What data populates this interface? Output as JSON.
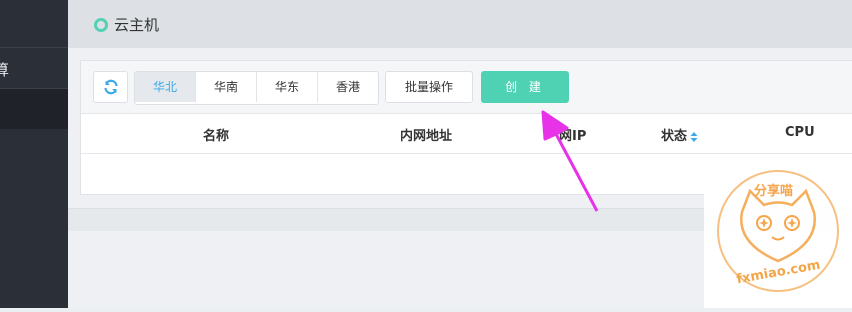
{
  "sidebar": {
    "items": [
      {
        "label": "算",
        "active": false
      },
      {
        "label": "",
        "active": true
      }
    ]
  },
  "header": {
    "title": "云主机",
    "status_color": "#55d0b5"
  },
  "toolbar": {
    "refresh_icon": "refresh-icon",
    "regions": [
      {
        "label": "华北",
        "active": true
      },
      {
        "label": "华南",
        "active": false
      },
      {
        "label": "华东",
        "active": false
      },
      {
        "label": "香港",
        "active": false
      }
    ],
    "batch_label": "批量操作",
    "create_label": "创 建",
    "accent_color": "#4fd1b3",
    "active_tab_color": "#3ba8e8"
  },
  "table": {
    "columns": [
      {
        "label": "名称"
      },
      {
        "label": "内网地址"
      },
      {
        "label": "网IP"
      },
      {
        "label": "状态",
        "sortable": true
      },
      {
        "label": "CPU"
      }
    ],
    "rows": []
  },
  "watermark": {
    "top_text": "分享喵",
    "bottom_text": "fxmiao.com",
    "color": "#f4a54a"
  },
  "annotation": {
    "color": "#e832e8"
  }
}
